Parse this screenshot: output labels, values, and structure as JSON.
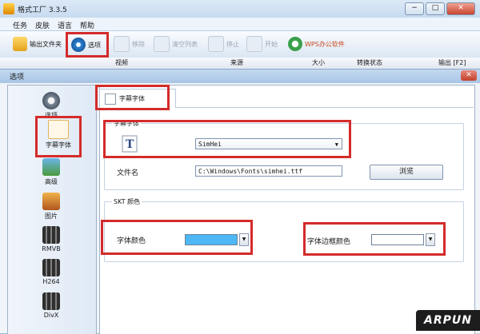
{
  "main_window": {
    "title": "格式工厂 3.3.5",
    "controls": {
      "minimize": "−",
      "restore": "□",
      "close": "✕"
    },
    "menu": [
      "任务",
      "皮肤",
      "语言",
      "帮助"
    ],
    "toolbar": {
      "output_folder": "输出文件夹",
      "options": "选项",
      "remove": "移除",
      "clear_list": "清空列表",
      "stop": "停止",
      "start": "开始",
      "wps": "WPS办公软件"
    },
    "columns": {
      "source": "来源",
      "size": "大小",
      "status": "转换状态",
      "output": "输出 [F2]",
      "preview": "视频"
    }
  },
  "dialog": {
    "title": "选项",
    "close": "✕",
    "sidebar": [
      {
        "label": "选项",
        "icon": "options-icon"
      },
      {
        "label": "字幕字体",
        "icon": "subtitle-font-icon",
        "selected": true
      },
      {
        "label": "高级",
        "icon": "advanced-icon"
      },
      {
        "label": "图片",
        "icon": "picture-icon"
      },
      {
        "label": "RMVB",
        "icon": "rmvb-film-icon"
      },
      {
        "label": "H264",
        "icon": "h264-film-icon"
      },
      {
        "label": "DivX",
        "icon": "divx-film-icon"
      }
    ],
    "tab": "字幕字体",
    "font_group": {
      "label": "字幕字体",
      "font": "SimHei",
      "filename_label": "文件名",
      "filename": "C:\\Windows\\Fonts\\simhei.ttf",
      "browse": "浏览"
    },
    "ssa_group": {
      "label": "SKT 颜色",
      "font_color_label": "字体颜色",
      "font_color": "#4db8f5",
      "border_color_label": "字体边框颜色",
      "border_color": "#ffffff"
    }
  },
  "watermark": "ARPUN"
}
